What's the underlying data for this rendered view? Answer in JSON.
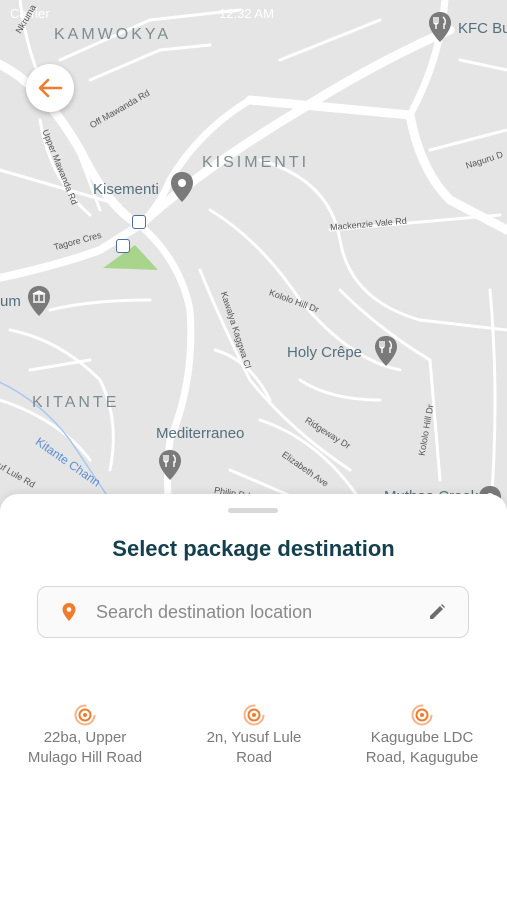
{
  "status_bar": {
    "carrier": "Carrier",
    "time": "12:32 AM"
  },
  "map": {
    "areas": [
      "KAMWOKYA",
      "KISIMENTI",
      "KITANTE"
    ],
    "pois": [
      "Kisementi",
      "Holy Crêpe",
      "Mediterraneo",
      "KFC Bu",
      "um",
      "Muthaa Creek"
    ],
    "streets": [
      "Nkruma",
      "Off Mawanda Rd",
      "Upper Mawanda Rd",
      "Tagore Cres",
      "Naguru D",
      "Mackenzie Vale Rd",
      "Kololo Hill Dr",
      "Kawalya Kaggwa Cl",
      "Ridgeway Dr",
      "Elizabeth Ave",
      "Kololo Hill Dr",
      "Kitante Chann",
      "Philip Rd",
      "uf Lule Rd"
    ]
  },
  "sheet": {
    "title": "Select package destination",
    "search_placeholder": "Search destination location",
    "recent": [
      {
        "line1": "22ba, Upper",
        "line2": "Mulago Hill Road"
      },
      {
        "line1": "2n, Yusuf Lule",
        "line2": "Road"
      },
      {
        "line1": "Kagugube LDC",
        "line2": "Road, Kagugube"
      }
    ]
  },
  "colors": {
    "accent": "#ef7d2d",
    "title": "#143f4c",
    "park": "#a8d58b",
    "map_bg": "#e5e5e5"
  }
}
